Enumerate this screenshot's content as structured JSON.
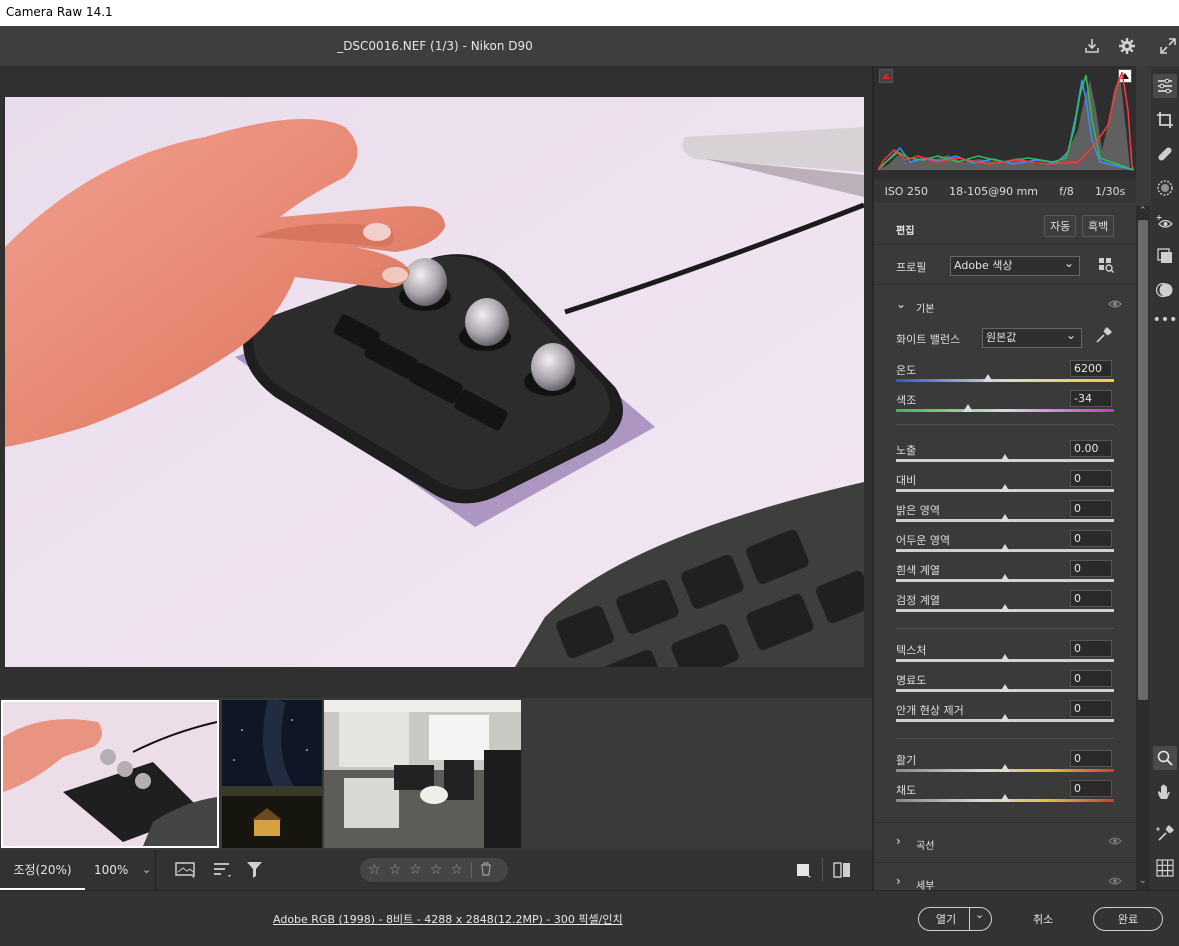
{
  "window": {
    "title": "Camera Raw 14.1"
  },
  "header": {
    "filename": "_DSC0016.NEF (1/3)  -  Nikon D90",
    "save_icon": "download-icon",
    "settings_icon": "gear-icon",
    "fullscreen_icon": "expand-icon"
  },
  "exif": {
    "iso": "ISO 250",
    "lens": "18-105@90 mm",
    "aperture": "f/8",
    "shutter": "1/30s"
  },
  "edit": {
    "title": "편집",
    "auto_label": "자동",
    "bw_label": "흑백"
  },
  "profile": {
    "label": "프로필",
    "value": "Adobe 색상",
    "browse_icon": "grid-search-icon"
  },
  "basic": {
    "title": "기본",
    "wb_label": "화이트 밸런스",
    "wb_value": "원본값",
    "temp": {
      "label": "온도",
      "value": "6200",
      "position": 0.42
    },
    "tint": {
      "label": "색조",
      "value": "-34",
      "position": 0.33
    },
    "exposure": {
      "label": "노출",
      "value": "0.00",
      "position": 0.5
    },
    "contrast": {
      "label": "대비",
      "value": "0",
      "position": 0.5
    },
    "highlights": {
      "label": "밝은 영역",
      "value": "0",
      "position": 0.5
    },
    "shadows": {
      "label": "어두운 영역",
      "value": "0",
      "position": 0.5
    },
    "whites": {
      "label": "흰색 계열",
      "value": "0",
      "position": 0.5
    },
    "blacks": {
      "label": "검정 계열",
      "value": "0",
      "position": 0.5
    },
    "texture": {
      "label": "텍스처",
      "value": "0",
      "position": 0.5
    },
    "clarity": {
      "label": "명료도",
      "value": "0",
      "position": 0.5
    },
    "dehaze": {
      "label": "안개 현상 제거",
      "value": "0",
      "position": 0.5
    },
    "vibrance": {
      "label": "활기",
      "value": "0",
      "position": 0.5
    },
    "saturation": {
      "label": "채도",
      "value": "0",
      "position": 0.5
    }
  },
  "sections": {
    "curve": "곡선",
    "detail": "세부"
  },
  "bottombar": {
    "zoom_fit": "조정(20%)",
    "zoom_100": "100%",
    "stars": [
      "☆",
      "☆",
      "☆",
      "☆",
      "☆"
    ]
  },
  "footer": {
    "info": "Adobe RGB (1998) - 8비트 - 4288 x 2848(12.2MP) - 300 픽셀/인치",
    "open_label": "열기",
    "cancel_label": "취소",
    "done_label": "완료"
  },
  "colors": {
    "accent": "#1473e6",
    "panel": "#3a3a3a",
    "red_clip": "#e02020"
  }
}
